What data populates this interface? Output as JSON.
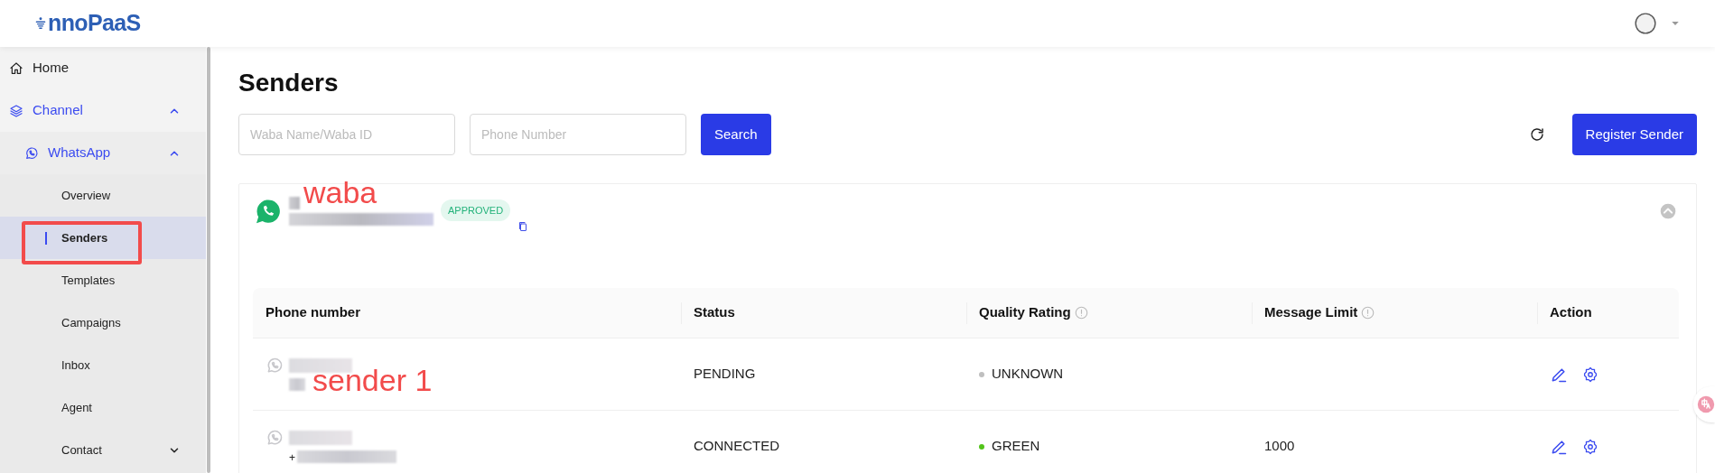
{
  "header": {
    "logo": "nnoPaaS"
  },
  "sidebar": {
    "items": [
      {
        "label": "Home",
        "active": false
      },
      {
        "label": "Channel",
        "expanded": true,
        "active": true,
        "children": [
          {
            "label": "WhatsApp",
            "expanded": true,
            "active": true,
            "children": [
              {
                "label": "Overview",
                "selected": false
              },
              {
                "label": "Senders",
                "selected": true
              },
              {
                "label": "Templates",
                "selected": false
              },
              {
                "label": "Campaigns",
                "selected": false
              },
              {
                "label": "Inbox",
                "selected": false
              },
              {
                "label": "Agent",
                "selected": false
              },
              {
                "label": "Contact",
                "selected": false,
                "expanded": false
              }
            ]
          }
        ]
      }
    ]
  },
  "page": {
    "title": "Senders",
    "filters": [
      {
        "placeholder": "Waba Name/Waba ID"
      },
      {
        "placeholder": "Phone Number"
      }
    ],
    "search_button": "Search",
    "register_button": "Register Sender"
  },
  "waba": {
    "status": "APPROVED",
    "expanded": true
  },
  "table": {
    "columns": [
      {
        "label": "Phone number",
        "info": false
      },
      {
        "label": "Status",
        "info": false
      },
      {
        "label": "Quality Rating",
        "info": true
      },
      {
        "label": "Message Limit",
        "info": true
      },
      {
        "label": "Action",
        "info": false
      }
    ],
    "rows": [
      {
        "status": "PENDING",
        "quality": "UNKNOWN",
        "color": "#bfbfbf"
      },
      {
        "phone_prefix": "+",
        "status": "CONNECTED",
        "quality": "GREEN",
        "color": "#52c41a",
        "limit": "1000"
      }
    ]
  },
  "annotations": [
    {
      "kind": "text",
      "text": "waba"
    },
    {
      "kind": "box"
    },
    {
      "kind": "text",
      "text": "sender 1"
    }
  ]
}
